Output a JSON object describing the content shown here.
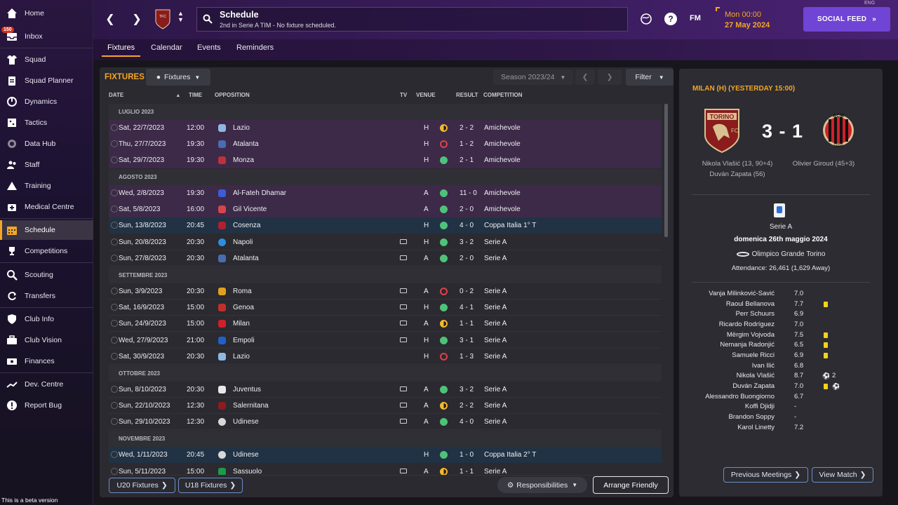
{
  "sidebar": {
    "inbox_badge": "150",
    "items": [
      {
        "label": "Home",
        "icon": "home-icon"
      },
      {
        "label": "Inbox",
        "icon": "inbox-icon"
      },
      {
        "label": "Squad",
        "icon": "shirt-icon"
      },
      {
        "label": "Squad Planner",
        "icon": "clipboard-icon"
      },
      {
        "label": "Dynamics",
        "icon": "dynamics-icon"
      },
      {
        "label": "Tactics",
        "icon": "tactics-icon"
      },
      {
        "label": "Data Hub",
        "icon": "data-hub-icon"
      },
      {
        "label": "Staff",
        "icon": "staff-icon"
      },
      {
        "label": "Training",
        "icon": "training-icon"
      },
      {
        "label": "Medical Centre",
        "icon": "medical-icon"
      },
      {
        "label": "Schedule",
        "icon": "calendar-icon"
      },
      {
        "label": "Competitions",
        "icon": "trophy-icon"
      },
      {
        "label": "Scouting",
        "icon": "scouting-icon"
      },
      {
        "label": "Transfers",
        "icon": "transfers-icon"
      },
      {
        "label": "Club Info",
        "icon": "shield-icon"
      },
      {
        "label": "Club Vision",
        "icon": "briefcase-icon"
      },
      {
        "label": "Finances",
        "icon": "money-icon"
      },
      {
        "label": "Dev. Centre",
        "icon": "dev-centre-icon"
      },
      {
        "label": "Report Bug",
        "icon": "bug-report-icon"
      }
    ],
    "beta_text": "This is a beta version"
  },
  "topbar": {
    "title": "Schedule",
    "subtitle": "2nd in Serie A TIM - No fixture scheduled.",
    "fm_label": "FM",
    "time": "Mon 00:00",
    "date": "27 May 2024",
    "social_feed": "SOCIAL FEED",
    "version": "ENG"
  },
  "tabs": [
    "Fixtures",
    "Calendar",
    "Events",
    "Reminders"
  ],
  "fixtures": {
    "title": "FIXTURES",
    "filter_dropdown": "Fixtures",
    "season": "Season 2023/24",
    "filter_btn": "Filter",
    "columns": {
      "date": "DATE",
      "time": "TIME",
      "opposition": "OPPOSITION",
      "tv": "TV",
      "venue": "VENUE",
      "result": "RESULT",
      "competition": "COMPETITION"
    },
    "months": {
      "m1": "LUGLIO 2023",
      "m2": "AGOSTO 2023",
      "m3": "SETTEMBRE 2023",
      "m4": "OTTOBRE 2023",
      "m5": "NOVEMBRE 2023"
    },
    "rows": [
      {
        "date": "Sat, 22/7/2023",
        "time": "12:00",
        "opp": "Lazio",
        "venue": "H",
        "result": "2 - 2",
        "comp": "Amichevole"
      },
      {
        "date": "Thu, 27/7/2023",
        "time": "19:30",
        "opp": "Atalanta",
        "venue": "H",
        "result": "1 - 2",
        "comp": "Amichevole"
      },
      {
        "date": "Sat, 29/7/2023",
        "time": "19:30",
        "opp": "Monza",
        "venue": "H",
        "result": "2 - 1",
        "comp": "Amichevole"
      },
      {
        "date": "Wed, 2/8/2023",
        "time": "19:30",
        "opp": "Al-Fateh Dhamar",
        "venue": "A",
        "result": "11 - 0",
        "comp": "Amichevole"
      },
      {
        "date": "Sat, 5/8/2023",
        "time": "16:00",
        "opp": "Gil Vicente",
        "venue": "A",
        "result": "2 - 0",
        "comp": "Amichevole"
      },
      {
        "date": "Sun, 13/8/2023",
        "time": "20:45",
        "opp": "Cosenza",
        "venue": "H",
        "result": "4 - 0",
        "comp": "Coppa Italia 1° T"
      },
      {
        "date": "Sun, 20/8/2023",
        "time": "20:30",
        "opp": "Napoli",
        "venue": "H",
        "result": "3 - 2",
        "comp": "Serie A"
      },
      {
        "date": "Sun, 27/8/2023",
        "time": "20:30",
        "opp": "Atalanta",
        "venue": "A",
        "result": "2 - 0",
        "comp": "Serie A"
      },
      {
        "date": "Sun, 3/9/2023",
        "time": "20:30",
        "opp": "Roma",
        "venue": "A",
        "result": "0 - 2",
        "comp": "Serie A"
      },
      {
        "date": "Sat, 16/9/2023",
        "time": "15:00",
        "opp": "Genoa",
        "venue": "H",
        "result": "4 - 1",
        "comp": "Serie A"
      },
      {
        "date": "Sun, 24/9/2023",
        "time": "15:00",
        "opp": "Milan",
        "venue": "A",
        "result": "1 - 1",
        "comp": "Serie A"
      },
      {
        "date": "Wed, 27/9/2023",
        "time": "21:00",
        "opp": "Empoli",
        "venue": "H",
        "result": "3 - 1",
        "comp": "Serie A"
      },
      {
        "date": "Sat, 30/9/2023",
        "time": "20:30",
        "opp": "Lazio",
        "venue": "H",
        "result": "1 - 3",
        "comp": "Serie A"
      },
      {
        "date": "Sun, 8/10/2023",
        "time": "20:30",
        "opp": "Juventus",
        "venue": "A",
        "result": "3 - 2",
        "comp": "Serie A"
      },
      {
        "date": "Sun, 22/10/2023",
        "time": "12:30",
        "opp": "Salernitana",
        "venue": "A",
        "result": "2 - 2",
        "comp": "Serie A"
      },
      {
        "date": "Sun, 29/10/2023",
        "time": "12:30",
        "opp": "Udinese",
        "venue": "A",
        "result": "4 - 0",
        "comp": "Serie A"
      },
      {
        "date": "Wed, 1/11/2023",
        "time": "20:45",
        "opp": "Udinese",
        "venue": "H",
        "result": "1 - 0",
        "comp": "Coppa Italia 2° T"
      },
      {
        "date": "Sun, 5/11/2023",
        "time": "15:00",
        "opp": "Sassuolo",
        "venue": "A",
        "result": "1 - 1",
        "comp": "Serie A"
      }
    ],
    "u20": "U20 Fixtures",
    "u18": "U18 Fixtures",
    "responsibilities": "Responsibilities",
    "arrange_friendly": "Arrange Friendly"
  },
  "match": {
    "header": "MILAN (H) (YESTERDAY 15:00)",
    "score": "3 - 1",
    "home_scorers": "Nikola Vlašić (13, 90+4)",
    "home_scorers2": "Duván Zapata (56)",
    "away_scorers": "Olivier Giroud (45+3)",
    "competition": "Serie A",
    "date": "domenica 26th maggio 2024",
    "stadium": "Olimpico Grande Torino",
    "attendance": "Attendance: 26,461 (1,629 Away)",
    "players": [
      {
        "name": "Vanja Milinković-Savić",
        "rating": "7.0"
      },
      {
        "name": "Raoul Bellanova",
        "rating": "7.7"
      },
      {
        "name": "Perr Schuurs",
        "rating": "6.9"
      },
      {
        "name": "Ricardo Rodríguez",
        "rating": "7.0"
      },
      {
        "name": "Mërgim Vojvoda",
        "rating": "7.5"
      },
      {
        "name": "Nemanja Radonjić",
        "rating": "6.5"
      },
      {
        "name": "Samuele Ricci",
        "rating": "6.9"
      },
      {
        "name": "Ivan Ilić",
        "rating": "6.8"
      },
      {
        "name": "Nikola Vlašić",
        "rating": "8.7",
        "goals": "2"
      },
      {
        "name": "Duván Zapata",
        "rating": "7.0"
      },
      {
        "name": "Alessandro Buongiorno",
        "rating": "6.7"
      },
      {
        "name": "Koffi Djidji",
        "rating": "-"
      },
      {
        "name": "Brandon Soppy",
        "rating": "-"
      },
      {
        "name": "Karol Linetty",
        "rating": "7.2"
      }
    ],
    "prev_meetings": "Previous Meetings",
    "view_match": "View Match"
  }
}
